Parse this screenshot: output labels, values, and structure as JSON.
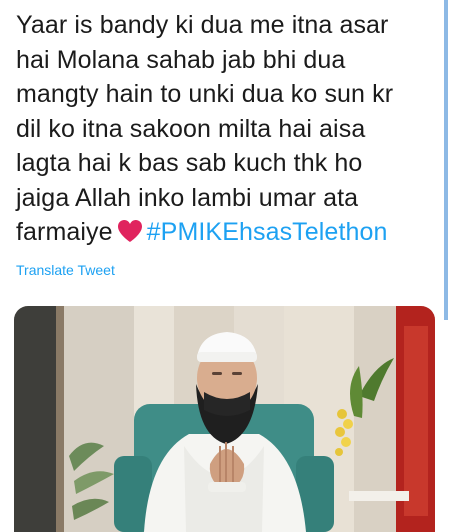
{
  "tweet": {
    "text_lines": [
      "Yaar is bandy ki dua me itna asar",
      "hai Molana sahab jab bhi dua",
      "mangty hain to unki dua ko sun kr",
      "dil ko itna sakoon milta hai aisa",
      "lagta hai k bas sab kuch thk ho",
      "jaiga Allah inko lambi umar ata"
    ],
    "last_line_prefix": "farmaiye",
    "hashtag": "#PMIKEhsasTelethon",
    "translate_label": "Translate Tweet"
  },
  "media": {
    "type": "video-thumbnail",
    "subject": "man in white cap and white clothes praying on a teal chair"
  },
  "colors": {
    "link": "#1da1f2",
    "heart": "#e0245e",
    "text": "#14171a"
  },
  "icons": [
    "red-heart-emoji-icon"
  ]
}
